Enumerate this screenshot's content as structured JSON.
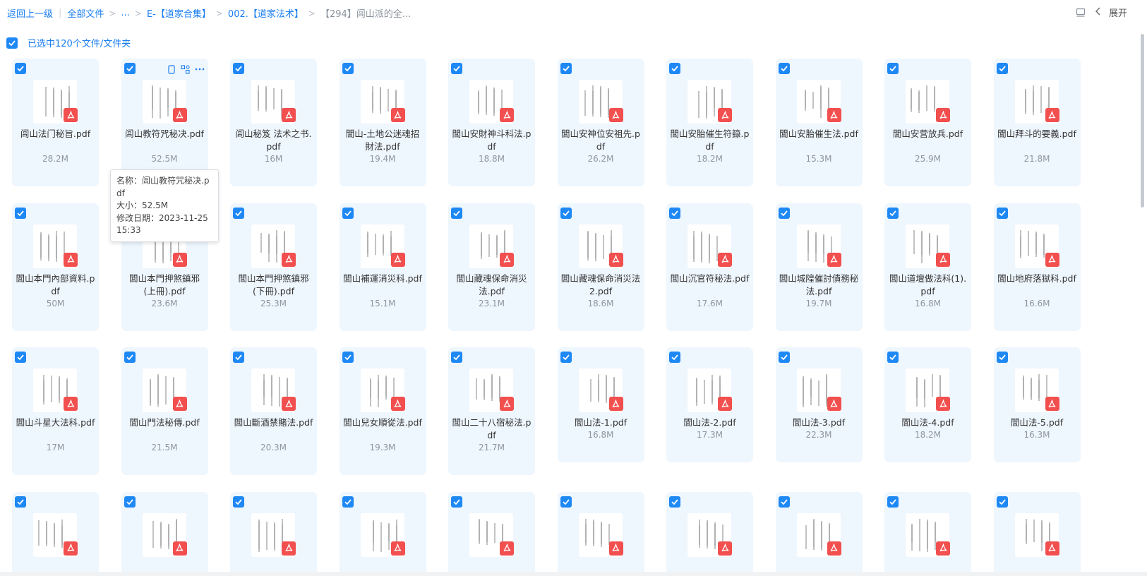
{
  "breadcrumb": {
    "back": "返回上一级",
    "all_files": "全部文件",
    "ellipsis": "...",
    "level1": "E-【道家合集】",
    "level2": "002.【道家法术】",
    "current": "【294】闾山派的全..."
  },
  "toolbar": {
    "expand_label": "展开"
  },
  "selection": {
    "text": "已选中120个文件/文件夹"
  },
  "files": [
    {
      "name": "闾山法门秘旨.pdf",
      "size": "28.2M"
    },
    {
      "name": "闾山教符咒秘决.pdf",
      "size": "52.5M"
    },
    {
      "name": "闾山秘笈 法术之书.pdf",
      "size": "16M"
    },
    {
      "name": "閭山-土地公迷魂招財法.pdf",
      "size": "19.4M"
    },
    {
      "name": "閭山安財神斗科法.pdf",
      "size": "18.8M"
    },
    {
      "name": "閭山安神位安祖先.pdf",
      "size": "26.2M"
    },
    {
      "name": "閭山安胎催生符籙.pdf",
      "size": "18.2M"
    },
    {
      "name": "閭山安胎催生法.pdf",
      "size": "15.3M"
    },
    {
      "name": "閭山安营放兵.pdf",
      "size": "25.9M"
    },
    {
      "name": "閭山拜斗的要義.pdf",
      "size": "21.8M"
    },
    {
      "name": "閭山本門內部資料.pdf",
      "size": "50M"
    },
    {
      "name": "閭山本門押煞鎮邪(上冊).pdf",
      "size": "23.6M"
    },
    {
      "name": "閭山本門押煞鎮邪(下冊).pdf",
      "size": "25.3M"
    },
    {
      "name": "閭山補運消災科.pdf",
      "size": "15.1M"
    },
    {
      "name": "閭山藏魂保命消災法.pdf",
      "size": "23.1M"
    },
    {
      "name": "閭山藏魂保命消災法2.pdf",
      "size": "18.6M"
    },
    {
      "name": "閭山沉官符秘法.pdf",
      "size": "17.6M"
    },
    {
      "name": "閭山城隍催討債務秘法.pdf",
      "size": "19.7M"
    },
    {
      "name": "閭山道壇做法科(1).pdf",
      "size": "16.8M"
    },
    {
      "name": "閭山地府落獄科.pdf",
      "size": "16.6M"
    },
    {
      "name": "閭山斗星大法科.pdf",
      "size": "17M"
    },
    {
      "name": "閭山門法秘傳.pdf",
      "size": "21.5M"
    },
    {
      "name": "閭山斷酒禁賭法.pdf",
      "size": "20.3M"
    },
    {
      "name": "閭山兒女順從法.pdf",
      "size": "19.3M"
    },
    {
      "name": "閭山二十八宿秘法.pdf",
      "size": "21.7M"
    },
    {
      "name": "閭山法-1.pdf",
      "size": "16.8M"
    },
    {
      "name": "閭山法-2.pdf",
      "size": "17.3M"
    },
    {
      "name": "閭山法-3.pdf",
      "size": "22.3M"
    },
    {
      "name": "閭山法-4.pdf",
      "size": "18.2M"
    },
    {
      "name": "閭山法-5.pdf",
      "size": "16.3M"
    },
    {
      "name": "",
      "size": ""
    },
    {
      "name": "",
      "size": ""
    },
    {
      "name": "",
      "size": ""
    },
    {
      "name": "",
      "size": ""
    },
    {
      "name": "",
      "size": ""
    },
    {
      "name": "",
      "size": ""
    },
    {
      "name": "",
      "size": ""
    },
    {
      "name": "",
      "size": ""
    },
    {
      "name": "",
      "size": ""
    },
    {
      "name": "",
      "size": ""
    }
  ],
  "tooltip": {
    "name_line": "名称：闾山教符咒秘决.pdf",
    "size_line": "大小：52.5M",
    "date_line": "修改日期：2023-11-25 15:33"
  },
  "colors": {
    "accent": "#1a7ef2",
    "card_bg": "#eef6fe",
    "pdf_badge": "#f24f4f"
  }
}
